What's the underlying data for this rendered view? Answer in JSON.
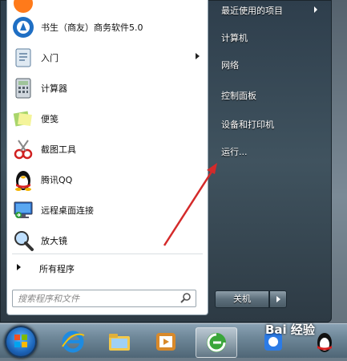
{
  "start_menu": {
    "programs": [
      {
        "label": "书生（商友）商务软件5.0",
        "icon": "shusheng-app-icon",
        "has_submenu": false
      },
      {
        "label": "入门",
        "icon": "getting-started-icon",
        "has_submenu": true
      },
      {
        "label": "计算器",
        "icon": "calculator-icon",
        "has_submenu": false
      },
      {
        "label": "便笺",
        "icon": "sticky-notes-icon",
        "has_submenu": false
      },
      {
        "label": "截图工具",
        "icon": "snipping-tool-icon",
        "has_submenu": false
      },
      {
        "label": "腾讯QQ",
        "icon": "qq-penguin-icon",
        "has_submenu": false
      },
      {
        "label": "远程桌面连接",
        "icon": "remote-desktop-icon",
        "has_submenu": false
      },
      {
        "label": "放大镜",
        "icon": "magnifier-icon",
        "has_submenu": false
      }
    ],
    "all_programs_label": "所有程序",
    "search": {
      "placeholder": "搜索程序和文件"
    },
    "right_items": [
      {
        "label": "最近使用的项目",
        "has_submenu": true
      },
      {
        "label": "计算机",
        "has_submenu": false
      },
      {
        "label": "网络",
        "has_submenu": false
      },
      {
        "label": "控制面板",
        "has_submenu": false
      },
      {
        "label": "设备和打印机",
        "has_submenu": false
      },
      {
        "label": "运行...",
        "has_submenu": false
      }
    ],
    "shutdown_label": "关机"
  },
  "taskbar": {
    "buttons": [
      "start-orb",
      "internet-explorer",
      "windows-explorer",
      "media-player",
      "360-browser",
      "app-icon",
      "qq-penguin"
    ]
  },
  "watermark": {
    "text": "Bai 经验"
  },
  "colors": {
    "annotation_arrow": "#d42a2a",
    "menu_dark": "#2e3e4c",
    "accent_blue": "#1c64b8"
  }
}
